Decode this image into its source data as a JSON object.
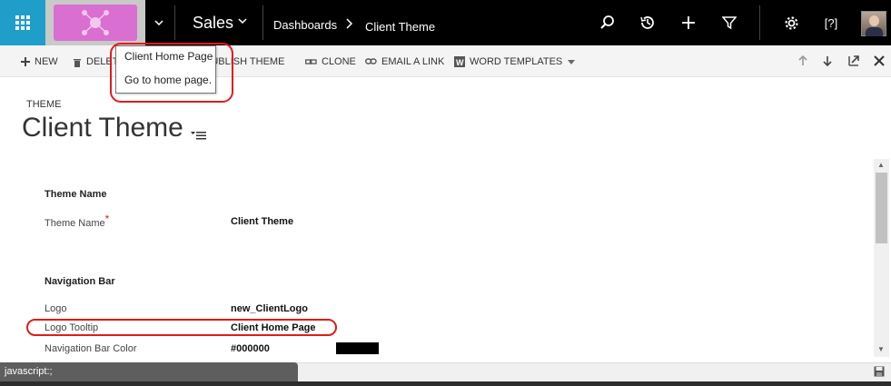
{
  "nav": {
    "app_name": "Sales",
    "breadcrumb_root": "Dashboards",
    "breadcrumb_current": "Client Theme",
    "waffle_color": "#1e9ec9",
    "logo_color": "#d96fd1",
    "icons": [
      "search-icon",
      "history-icon",
      "plus-icon",
      "filter-icon",
      "gear-icon",
      "help-icon"
    ],
    "help_glyph": "[?]"
  },
  "commands": {
    "new": "NEW",
    "delete": "DELETE",
    "publish_theme": "PUBLISH THEME",
    "clone": "CLONE",
    "email_link": "EMAIL A LINK",
    "word_templates": "WORD TEMPLATES"
  },
  "tooltip": {
    "title": "Client Home Page",
    "text": "Go to home page."
  },
  "header": {
    "entity_type": "THEME",
    "record_title": "Client Theme"
  },
  "form": {
    "theme_section_title": "Theme Name",
    "theme_name_label": "Theme Name",
    "required_marker": "*",
    "theme_name_value": "Client Theme",
    "nav_section_title": "Navigation Bar",
    "logo_label": "Logo",
    "logo_value": "new_ClientLogo",
    "logo_tooltip_label": "Logo Tooltip",
    "logo_tooltip_value": "Client Home Page",
    "nav_color_label": "Navigation Bar Color",
    "nav_color_value": "#000000",
    "swatch_color": "#000000"
  },
  "status": {
    "text": "javascript:;"
  },
  "highlight_color": "#e21b1b"
}
